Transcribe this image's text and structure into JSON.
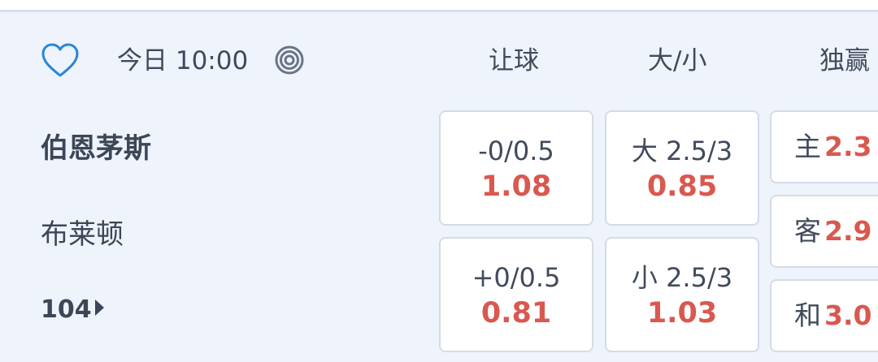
{
  "match": {
    "kickoff": "今日 10:00",
    "home_team": "伯恩茅斯",
    "away_team": "布莱顿",
    "more_count": "104"
  },
  "icons": {
    "favorite": "heart-outline-icon",
    "live": "target-icon",
    "more": "triangle-right-icon"
  },
  "columns": {
    "handicap": "让球",
    "over_under": "大/小",
    "win": "独赢"
  },
  "handicap": {
    "home": {
      "line": "-0/0.5",
      "odds": "1.08"
    },
    "away": {
      "line": "+0/0.5",
      "odds": "0.81"
    }
  },
  "over_under": {
    "over": {
      "line": "大 2.5/3",
      "odds": "0.85"
    },
    "under": {
      "line": "小 2.5/3",
      "odds": "1.03"
    }
  },
  "win": {
    "home": {
      "label": "主",
      "odds": "2.3"
    },
    "away": {
      "label": "客",
      "odds": "2.9"
    },
    "draw": {
      "label": "和",
      "odds": "3.0"
    }
  },
  "colors": {
    "background": "#eef3fc",
    "accent_icon": "#2a86d9",
    "odds": "#d9584f",
    "text": "#414a5b"
  }
}
